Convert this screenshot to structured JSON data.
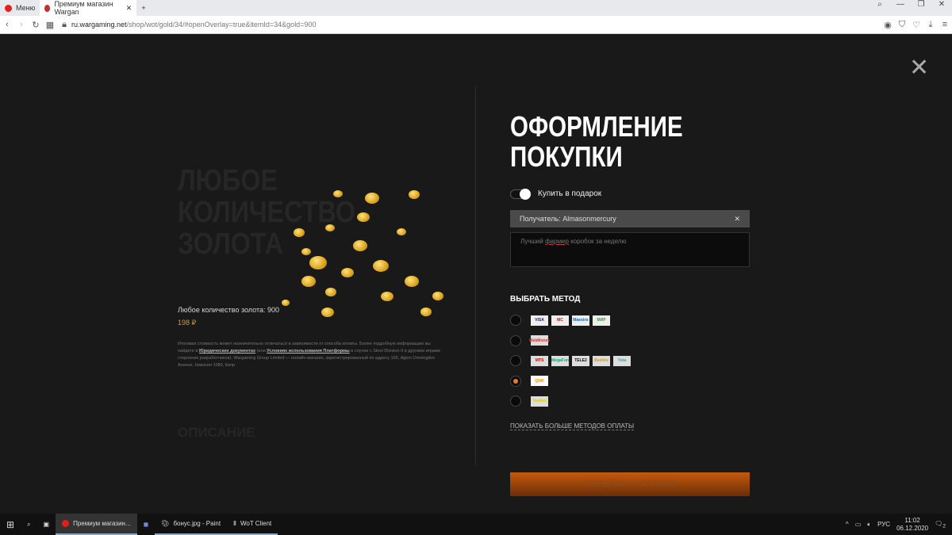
{
  "browser": {
    "menu_label": "Меню",
    "tab_title": "Премиум магазин Wargan",
    "url_host": "ru.wargaming.net",
    "url_path": "/shop/wot/gold/34/#openOverlay=true&itemId=34&gold=900"
  },
  "background": {
    "title": "ЛЮБОЕ КОЛИЧЕСТВО ЗОЛОТА",
    "description_heading": "ОПИСАНИЕ",
    "product_name": "Любое количество золота: 900",
    "price": "198 ₽",
    "legal_1": "Итоговая стоимость может незначительно отличаться в зависимости от способа оплаты. Более подробную информацию вы найдёте в ",
    "legal_link1": "Юридических документах",
    "legal_2": " (или ",
    "legal_link2": "Условиях использования Платформы",
    "legal_3": " в случае с Steel Division II и другими играми сторонних разработчиков). Wargaming Group Limited — онлайн-магазин, зарегистрированный по адресу 105, Agion Omologiton Avenue, Никосия 1080, Кипр"
  },
  "checkout": {
    "title_line1": "ОФОРМЛЕНИЕ",
    "title_line2": "ПОКУПКИ",
    "gift_label": "Купить в подарок",
    "gift_enabled": true,
    "recipient": "Получатель: Almasonmercury",
    "message_pre": "Лучший ",
    "message_misspelled": "фармер",
    "message_post": " коробок за неделю",
    "method_heading": "ВЫБРАТЬ МЕТОД",
    "methods": [
      {
        "selected": false,
        "logos": [
          "VISA",
          "MC",
          "Maestro",
          "МИР"
        ]
      },
      {
        "selected": false,
        "logos": [
          "WebMoney"
        ]
      },
      {
        "selected": false,
        "logos": [
          "MTS",
          "MegaFon",
          "TELE2",
          "Beeline",
          "Yota"
        ]
      },
      {
        "selected": true,
        "logos": [
          "QIWI"
        ]
      },
      {
        "selected": false,
        "logos": [
          "Yandex"
        ]
      }
    ],
    "more_methods": "ПОКАЗАТЬ БОЛЬШЕ МЕТОДОВ ОПЛАТЫ",
    "pay_button": "ПЕРЕЙТИ К ОПЛАТЕ"
  },
  "taskbar": {
    "items": [
      "Премиум магазин...",
      "бонус.jpg - Paint",
      "WoT Client"
    ],
    "lang": "РУС",
    "time": "11:02",
    "date": "06.12.2020",
    "notif_count": "2"
  }
}
